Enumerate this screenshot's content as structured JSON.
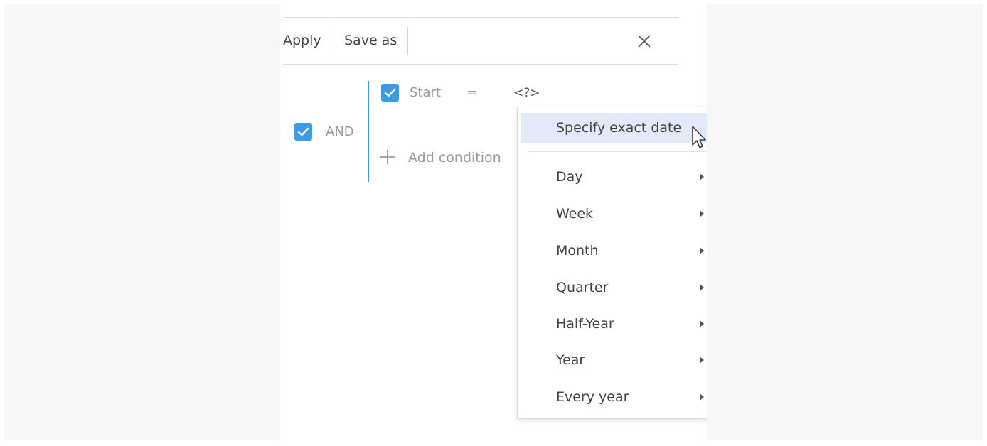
{
  "toolbar": {
    "apply_label": "Apply",
    "save_as_label": "Save as",
    "close_icon": "close-icon"
  },
  "filter": {
    "group_operator": "AND",
    "group_checked": true,
    "condition": {
      "checked": true,
      "column": "Start",
      "operator": "=",
      "value": "<?>"
    },
    "add_condition_label": "Add condition"
  },
  "date_menu": {
    "specify_exact_date": "Specify exact date",
    "items": [
      {
        "label": "Day"
      },
      {
        "label": "Week"
      },
      {
        "label": "Month"
      },
      {
        "label": "Quarter"
      },
      {
        "label": "Half-Year"
      },
      {
        "label": "Year"
      },
      {
        "label": "Every year"
      }
    ]
  },
  "colors": {
    "accent": "#3d9ae8",
    "menu_highlight": "#e2e9f8",
    "muted_text": "#9a9a9a"
  }
}
